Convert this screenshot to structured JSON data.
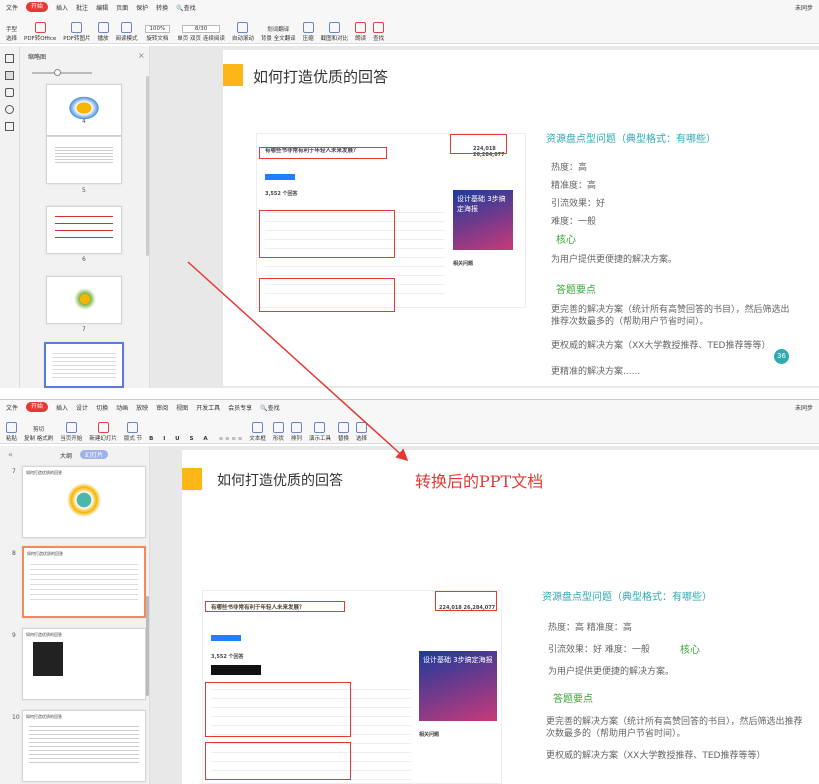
{
  "top": {
    "menu": [
      "文件",
      "开始",
      "插入",
      "批注",
      "编辑",
      "页面",
      "保护",
      "转换"
    ],
    "menu_active": "开始",
    "search": "查找",
    "unsaved": "未同步",
    "tools": [
      "手型",
      "选择",
      "PDF转Office",
      "PDF转图片",
      "播放",
      "阅读模式",
      "旋转文档",
      "单页",
      "双页",
      "连续阅读",
      "自动滚动",
      "背景",
      "全文翻译",
      "压缩",
      "截图和对比",
      "朗读",
      "查找"
    ],
    "zoom": "100%",
    "page": "8/30",
    "translate": "划词翻译",
    "sidebar_title": "缩略图",
    "thumbs": [
      "4",
      "5",
      "6",
      "7"
    ],
    "slide_title": "如何打造优质的回答",
    "right": {
      "h1": "资源盘点型问题（典型格式：有哪些）",
      "l1": "热度：高",
      "l2": "精准度：高",
      "l3": "引流效果：好",
      "l4": "难度：一般",
      "core": "核心",
      "p1": "为用户提供更便捷的解决方案。",
      "h2": "答题要点",
      "p2": "更完善的解决方案（统计所有高赞回答的书目），然后筛选出推荐次数最多的（帮助用户节省时间）。",
      "p3": "更权威的解决方案（XX大学教授推荐、TED推荐等等）",
      "p4": "更精准的解决方案......",
      "badge": "36"
    }
  },
  "bottom": {
    "menu": [
      "文件",
      "开始",
      "插入",
      "设计",
      "切换",
      "动画",
      "放映",
      "审阅",
      "视图",
      "开发工具",
      "会员专享"
    ],
    "menu_active": "开始",
    "search": "查找",
    "unsaved": "未同步",
    "tools": [
      "粘贴",
      "剪切",
      "复制",
      "格式刷",
      "当页开始",
      "新建幻灯片",
      "版式",
      "节",
      "文本框",
      "形状",
      "排列",
      "演示工具",
      "替换",
      "选择"
    ],
    "panel_tabs": [
      "大纲",
      "幻灯片"
    ],
    "thumbs": [
      "7",
      "8",
      "9",
      "10"
    ],
    "thumb_title": "如何打造优质的回答",
    "slide_title": "如何打造优质的回答",
    "caption": "转换后的PPT文档",
    "right": {
      "h1": "资源盘点型问题（典型格式：有哪些）",
      "l1a": "热度：高 精准度：高",
      "l2a": "引流效果：好 难度：一般",
      "core": "核心",
      "p1": "为用户提供更便捷的解决方案。",
      "h2": "答题要点",
      "p2": "更完善的解决方案（统计所有高赞回答的书目），然后筛选出推荐次数最多的（帮助用户节省时间）。",
      "p3": "更权威的解决方案（XX大学教授推荐、TED推荐等等）"
    }
  },
  "shot": {
    "q": "有哪些书非常有利于年轻人未来发展？",
    "stats_a": "224,018",
    "stats_b": "26,284,077",
    "answers": "3,552 个回答",
    "ad": "设计基础 3步搞定海报",
    "rel": "相关问题"
  }
}
